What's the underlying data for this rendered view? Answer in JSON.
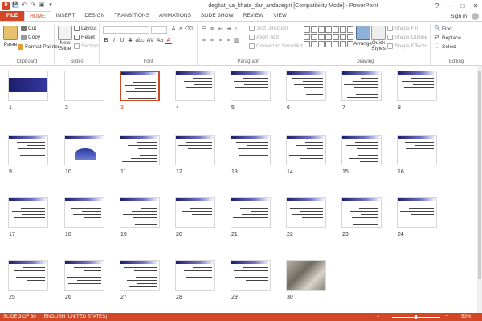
{
  "window": {
    "title": "deghat_va_khata_dar_andazegiri [Compatibility Mode] - PowerPoint",
    "help": "?",
    "minimize": "—",
    "maximize": "□",
    "close": "✕",
    "sign_in": "Sign in"
  },
  "qat": {
    "save": "💾",
    "undo": "↶",
    "redo": "↷",
    "start": "▣",
    "more": "▾"
  },
  "tabs": [
    {
      "label": "FILE"
    },
    {
      "label": "HOME"
    },
    {
      "label": "INSERT"
    },
    {
      "label": "DESIGN"
    },
    {
      "label": "TRANSITIONS"
    },
    {
      "label": "ANIMATIONS"
    },
    {
      "label": "SLIDE SHOW"
    },
    {
      "label": "REVIEW"
    },
    {
      "label": "VIEW"
    }
  ],
  "ribbon": {
    "clipboard": {
      "label": "Clipboard",
      "paste": "Paste",
      "cut": "Cut",
      "copy": "Copy",
      "format_painter": "Format Painter"
    },
    "slides": {
      "label": "Slides",
      "new_slide": "New",
      "new_slide2": "Slide",
      "layout": "Layout",
      "reset": "Reset",
      "section": "Section"
    },
    "font": {
      "label": "Font",
      "bold": "B",
      "italic": "I",
      "underline": "U",
      "strike": "S",
      "abc": "abc",
      "av": "AV",
      "aa": "Aa",
      "fontcolor": "A"
    },
    "paragraph": {
      "label": "Paragraph",
      "text_direction": "Text Direction",
      "align_text": "Align Text",
      "smartart": "Convert to SmartArt"
    },
    "drawing": {
      "label": "Drawing",
      "arrange": "Arrange",
      "quick_styles": "Quick",
      "quick_styles2": "Styles",
      "shape_fill": "Shape Fill",
      "shape_outline": "Shape Outline",
      "shape_effects": "Shape Effects"
    },
    "editing": {
      "label": "Editing",
      "find": "Find",
      "replace": "Replace",
      "select": "Select"
    }
  },
  "slides": [
    {
      "n": "1"
    },
    {
      "n": "2"
    },
    {
      "n": "3"
    },
    {
      "n": "4"
    },
    {
      "n": "5"
    },
    {
      "n": "6"
    },
    {
      "n": "7"
    },
    {
      "n": "8"
    },
    {
      "n": "9"
    },
    {
      "n": "10"
    },
    {
      "n": "11"
    },
    {
      "n": "12"
    },
    {
      "n": "13"
    },
    {
      "n": "14"
    },
    {
      "n": "15"
    },
    {
      "n": "16"
    },
    {
      "n": "17"
    },
    {
      "n": "18"
    },
    {
      "n": "19"
    },
    {
      "n": "20"
    },
    {
      "n": "21"
    },
    {
      "n": "22"
    },
    {
      "n": "23"
    },
    {
      "n": "24"
    },
    {
      "n": "25"
    },
    {
      "n": "26"
    },
    {
      "n": "27"
    },
    {
      "n": "28"
    },
    {
      "n": "29"
    },
    {
      "n": "30"
    }
  ],
  "selected_slide": 3,
  "status": {
    "slide_info": "SLIDE 3 OF 30",
    "language": "ENGLISH (UNITED STATES)",
    "zoom": "50%",
    "minus": "−",
    "plus": "+"
  },
  "colors": {
    "accent": "#d24726",
    "slide_header": "#1c1f6b"
  }
}
